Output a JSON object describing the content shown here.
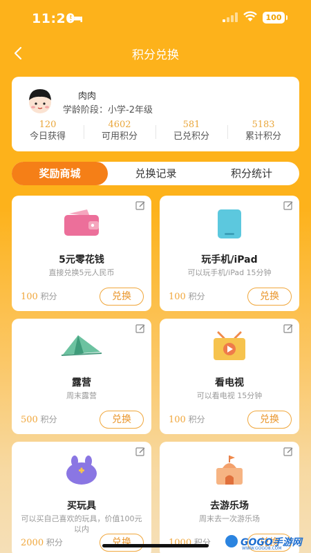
{
  "status_bar": {
    "time": "11:20",
    "battery": "100"
  },
  "nav": {
    "title": "积分兑换"
  },
  "profile": {
    "name": "肉肉",
    "level_label": "学龄阶段：",
    "level_value": "小学-2年级",
    "stats": [
      {
        "value": "120",
        "label": "今日获得"
      },
      {
        "value": "4602",
        "label": "可用积分"
      },
      {
        "value": "581",
        "label": "已兑积分"
      },
      {
        "value": "5183",
        "label": "累计积分"
      }
    ]
  },
  "tabs": [
    {
      "label": "奖励商城",
      "active": true
    },
    {
      "label": "兑换记录",
      "active": false
    },
    {
      "label": "积分统计",
      "active": false
    }
  ],
  "points_unit": "积分",
  "redeem_label": "兑换",
  "rewards": [
    {
      "title": "5元零花钱",
      "desc": "直接兑换5元人民币",
      "points": "100",
      "icon": "wallet-icon"
    },
    {
      "title": "玩手机/iPad",
      "desc": "可以玩手机/iPad 15分钟",
      "points": "100",
      "icon": "tablet-icon"
    },
    {
      "title": "露营",
      "desc": "周末露营",
      "points": "500",
      "icon": "tent-icon"
    },
    {
      "title": "看电视",
      "desc": "可以看电视 15分钟",
      "points": "100",
      "icon": "tv-icon"
    },
    {
      "title": "买玩具",
      "desc": "可以买自己喜欢的玩具，价值100元以内",
      "points": "2000",
      "icon": "toy-icon"
    },
    {
      "title": "去游乐场",
      "desc": "周末去一次游乐场",
      "points": "1000",
      "icon": "castle-icon"
    }
  ],
  "watermark": {
    "text": "GOGO手游网",
    "sub": "WWW.GOGO8.COM"
  },
  "colors": {
    "primary": "#fdb21b",
    "accent": "#f57f17",
    "points": "#f0a63a"
  }
}
